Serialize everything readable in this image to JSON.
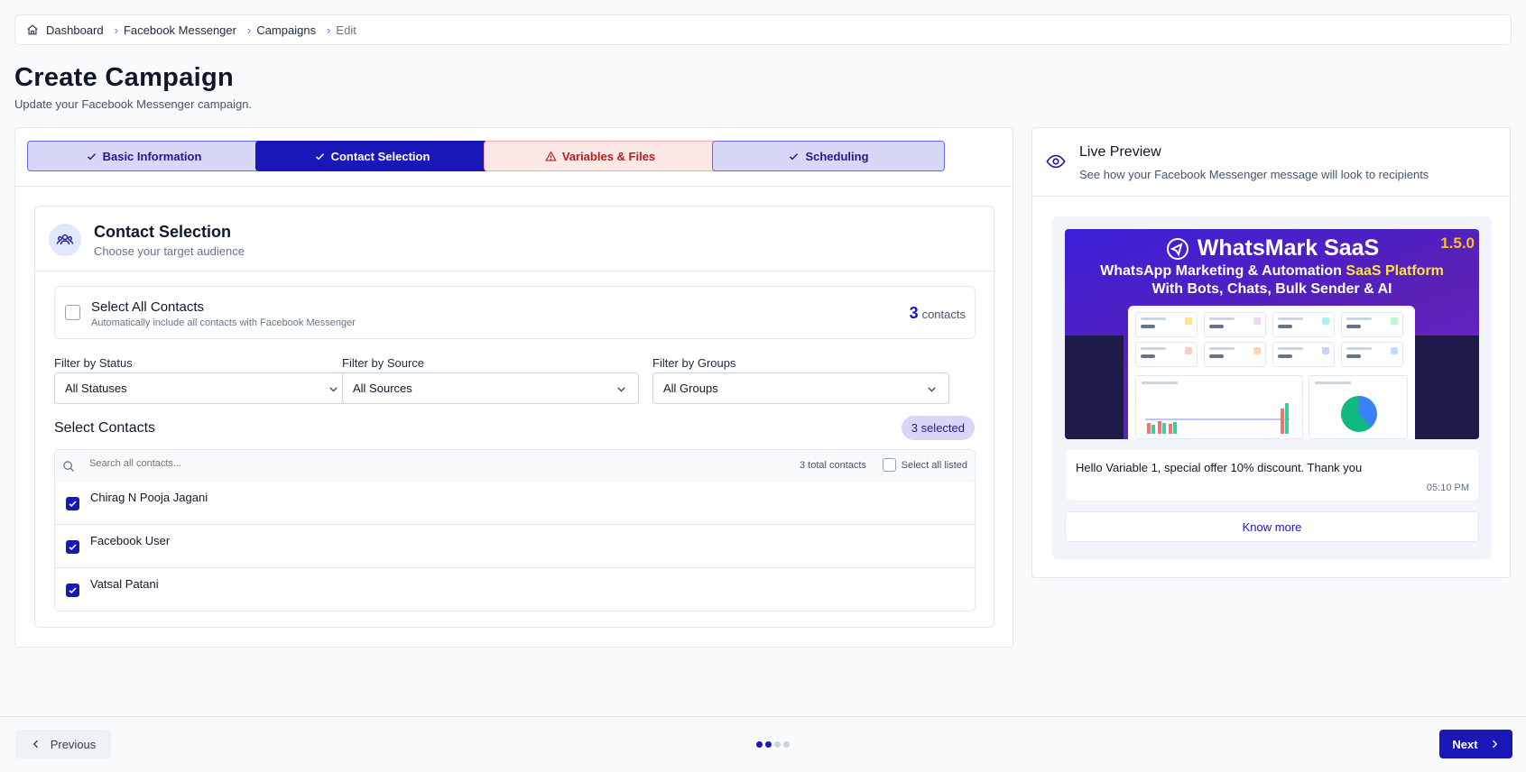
{
  "breadcrumb": {
    "items": [
      "Dashboard",
      "Facebook Messenger",
      "Campaigns",
      "Edit"
    ]
  },
  "page": {
    "title": "Create Campaign",
    "subtitle": "Update your Facebook Messenger campaign."
  },
  "steps": [
    {
      "label": "Basic Information",
      "state": "done"
    },
    {
      "label": "Contact Selection",
      "state": "active"
    },
    {
      "label": "Variables & Files",
      "state": "error"
    },
    {
      "label": "Scheduling",
      "state": "done"
    }
  ],
  "contact_section": {
    "title": "Contact Selection",
    "subtitle": "Choose your target audience",
    "select_all": {
      "title": "Select All Contacts",
      "subtitle": "Automatically include all contacts with Facebook Messenger",
      "count": "3",
      "count_label": "contacts",
      "checked": false
    },
    "filters": [
      {
        "label": "Filter by Status",
        "value": "All Statuses"
      },
      {
        "label": "Filter by Source",
        "value": "All Sources"
      },
      {
        "label": "Filter by Groups",
        "value": "All Groups"
      }
    ],
    "select_contacts_title": "Select Contacts",
    "selected_badge": "3 selected",
    "search_placeholder": "Search all contacts...",
    "total_contacts": "3 total contacts",
    "select_all_listed": "Select all listed",
    "contacts": [
      {
        "name": "Chirag N Pooja Jagani",
        "checked": true
      },
      {
        "name": "Facebook User",
        "checked": true
      },
      {
        "name": "Vatsal Patani",
        "checked": true
      }
    ]
  },
  "preview": {
    "title": "Live Preview",
    "subtitle": "See how your Facebook Messenger message will look to recipients",
    "banner": {
      "brand": "WhatsMark SaaS",
      "version": "1.5.0",
      "line1_prefix": "WhatsApp Marketing & Automation ",
      "line1_highlight": "SaaS Platform",
      "line2": "With Bots, Chats, Bulk Sender & AI"
    },
    "message": "Hello Variable 1, special offer 10% discount. Thank you",
    "time": "05:10 PM",
    "button_label": "Know more"
  },
  "footer": {
    "previous_label": "Previous",
    "next_label": "Next",
    "step_dots_total": 4,
    "step_dots_active": 2
  },
  "colors": {
    "primary": "#1a17b8",
    "step_done_bg": "#d9d7f7",
    "step_error_bg": "#fde8e8",
    "step_error_text": "#b91c1c"
  }
}
